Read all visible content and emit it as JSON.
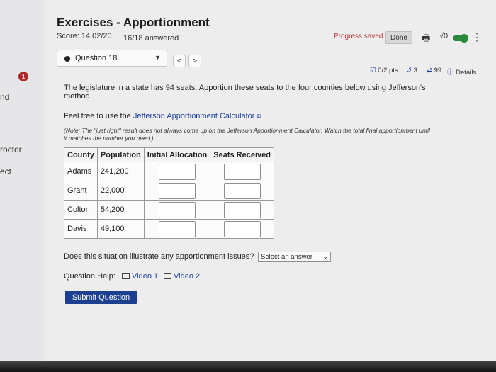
{
  "side": {
    "notification_count": "1",
    "label_and": "nd",
    "label_proctor": "roctor",
    "label_ect": "ect"
  },
  "header": {
    "title": "Exercises - Apportionment",
    "score": "Score: 14.02/20",
    "answered": "16/18 answered",
    "progress": "Progress saved",
    "done_label": "Done",
    "print_icon": "printer-icon",
    "math_icon": "√0"
  },
  "question_nav": {
    "selected": "Question 18",
    "prev": "<",
    "next": ">"
  },
  "meta": {
    "points": "0/2 pts",
    "retries": "3",
    "attempts": "99",
    "details": "Details"
  },
  "question": {
    "text": "The legislature in a state has 94 seats. Apportion these seats to the four counties below using Jefferson's method.",
    "calc_prefix": "Feel free to use the ",
    "calc_link": "Jefferson Apportionment Calculator",
    "note": "(Note: The \"just right\" result does not always come up on the Jefferson Apportionment Calculator. Watch the total final apportionment until it matches the number you need.)"
  },
  "table": {
    "headers": [
      "County",
      "Population",
      "Initial Allocation",
      "Seats Received"
    ],
    "rows": [
      {
        "county": "Adams",
        "population": "241,200"
      },
      {
        "county": "Grant",
        "population": "22,000"
      },
      {
        "county": "Colton",
        "population": "54,200"
      },
      {
        "county": "Davis",
        "population": "49,100"
      }
    ]
  },
  "issue": {
    "question": "Does this situation illustrate any apportionment issues?",
    "select_value": "Select an answer"
  },
  "help": {
    "label": "Question Help:",
    "video1": "Video 1",
    "video2": "Video 2"
  },
  "submit_label": "Submit Question",
  "colors": {
    "accent": "#1d3f8f",
    "link": "#1a3fa0",
    "progress": "#b8322e",
    "toggle": "#2b8a3e"
  }
}
